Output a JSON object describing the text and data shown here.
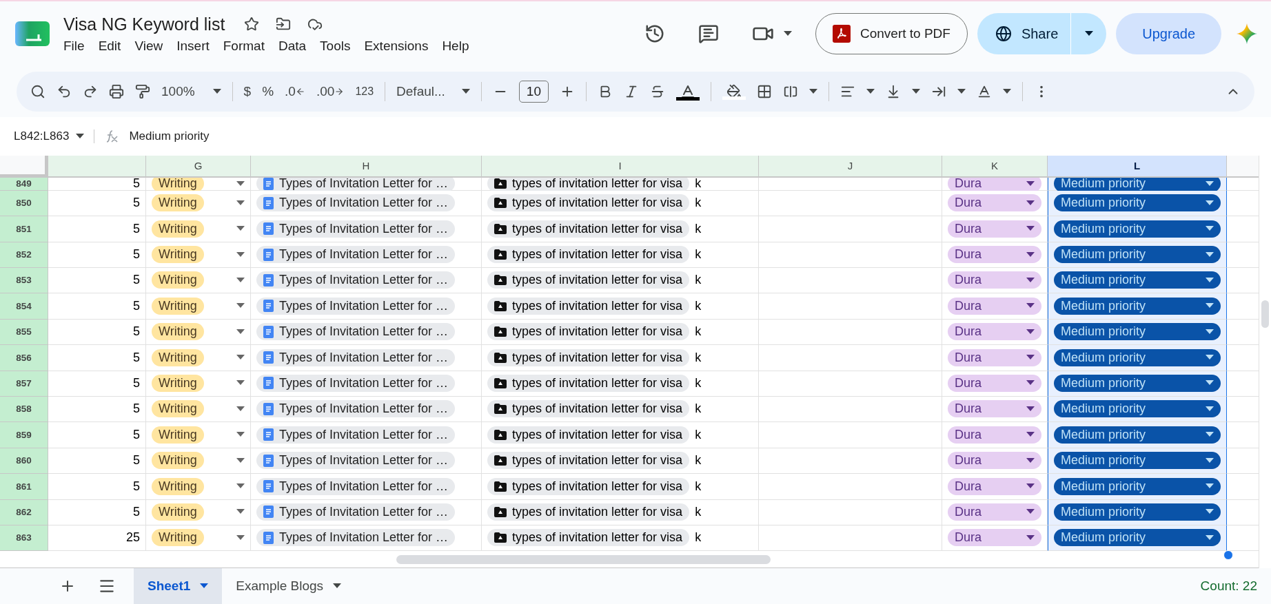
{
  "document": {
    "title": "Visa NG Keyword list"
  },
  "menu": [
    "File",
    "Edit",
    "View",
    "Insert",
    "Format",
    "Data",
    "Tools",
    "Extensions",
    "Help"
  ],
  "header_buttons": {
    "convert": "Convert to PDF",
    "share": "Share",
    "upgrade": "Upgrade"
  },
  "toolbar": {
    "zoom": "100%",
    "currency": "$",
    "percent": "%",
    "decrease_decimal": ".0",
    "increase_decimal": ".00",
    "number_format": "123",
    "font": "Defaul...",
    "font_size": "10"
  },
  "formula_bar": {
    "name_box": "L842:L863",
    "formula": "Medium priority"
  },
  "columns": [
    {
      "label": "G",
      "selected": false
    },
    {
      "label": "H",
      "selected": false
    },
    {
      "label": "I",
      "selected": false
    },
    {
      "label": "J",
      "selected": false
    },
    {
      "label": "K",
      "selected": false
    },
    {
      "label": "L",
      "selected": true
    }
  ],
  "rows": [
    {
      "number": "849",
      "selected": true,
      "value": "5",
      "status": "Writing",
      "title": "Types of Invitation Letter for …",
      "keyword": "types of invitation letter for visa",
      "extra": "k",
      "tag": "Dura",
      "priority": "Medium priority"
    },
    {
      "number": "850",
      "selected": true,
      "value": "5",
      "status": "Writing",
      "title": "Types of Invitation Letter for …",
      "keyword": "types of invitation letter for visa",
      "extra": "k",
      "tag": "Dura",
      "priority": "Medium priority"
    },
    {
      "number": "851",
      "selected": true,
      "value": "5",
      "status": "Writing",
      "title": "Types of Invitation Letter for …",
      "keyword": "types of invitation letter for visa",
      "extra": "k",
      "tag": "Dura",
      "priority": "Medium priority"
    },
    {
      "number": "852",
      "selected": true,
      "value": "5",
      "status": "Writing",
      "title": "Types of Invitation Letter for …",
      "keyword": "types of invitation letter for visa",
      "extra": "k",
      "tag": "Dura",
      "priority": "Medium priority"
    },
    {
      "number": "853",
      "selected": true,
      "value": "5",
      "status": "Writing",
      "title": "Types of Invitation Letter for …",
      "keyword": "types of invitation letter for visa",
      "extra": "k",
      "tag": "Dura",
      "priority": "Medium priority"
    },
    {
      "number": "854",
      "selected": true,
      "value": "5",
      "status": "Writing",
      "title": "Types of Invitation Letter for …",
      "keyword": "types of invitation letter for visa",
      "extra": "k",
      "tag": "Dura",
      "priority": "Medium priority"
    },
    {
      "number": "855",
      "selected": true,
      "value": "5",
      "status": "Writing",
      "title": "Types of Invitation Letter for …",
      "keyword": "types of invitation letter for visa",
      "extra": "k",
      "tag": "Dura",
      "priority": "Medium priority"
    },
    {
      "number": "856",
      "selected": true,
      "value": "5",
      "status": "Writing",
      "title": "Types of Invitation Letter for …",
      "keyword": "types of invitation letter for visa",
      "extra": "k",
      "tag": "Dura",
      "priority": "Medium priority"
    },
    {
      "number": "857",
      "selected": true,
      "value": "5",
      "status": "Writing",
      "title": "Types of Invitation Letter for …",
      "keyword": "types of invitation letter for visa",
      "extra": "k",
      "tag": "Dura",
      "priority": "Medium priority"
    },
    {
      "number": "858",
      "selected": true,
      "value": "5",
      "status": "Writing",
      "title": "Types of Invitation Letter for …",
      "keyword": "types of invitation letter for visa",
      "extra": "k",
      "tag": "Dura",
      "priority": "Medium priority"
    },
    {
      "number": "859",
      "selected": true,
      "value": "5",
      "status": "Writing",
      "title": "Types of Invitation Letter for …",
      "keyword": "types of invitation letter for visa",
      "extra": "k",
      "tag": "Dura",
      "priority": "Medium priority"
    },
    {
      "number": "860",
      "selected": true,
      "value": "5",
      "status": "Writing",
      "title": "Types of Invitation Letter for …",
      "keyword": "types of invitation letter for visa",
      "extra": "k",
      "tag": "Dura",
      "priority": "Medium priority"
    },
    {
      "number": "861",
      "selected": true,
      "value": "5",
      "status": "Writing",
      "title": "Types of Invitation Letter for …",
      "keyword": "types of invitation letter for visa",
      "extra": "k",
      "tag": "Dura",
      "priority": "Medium priority"
    },
    {
      "number": "862",
      "selected": true,
      "value": "5",
      "status": "Writing",
      "title": "Types of Invitation Letter for …",
      "keyword": "types of invitation letter for visa",
      "extra": "k",
      "tag": "Dura",
      "priority": "Medium priority"
    },
    {
      "number": "863",
      "selected": true,
      "value": "25",
      "status": "Writing",
      "title": "Types of Invitation Letter for …",
      "keyword": "types of invitation letter for visa",
      "extra": "k",
      "tag": "Dura",
      "priority": "Medium priority"
    }
  ],
  "sheets": [
    {
      "label": "Sheet1",
      "selected": true
    },
    {
      "label": "Example Blogs",
      "selected": false
    }
  ],
  "status": "Count: 22"
}
